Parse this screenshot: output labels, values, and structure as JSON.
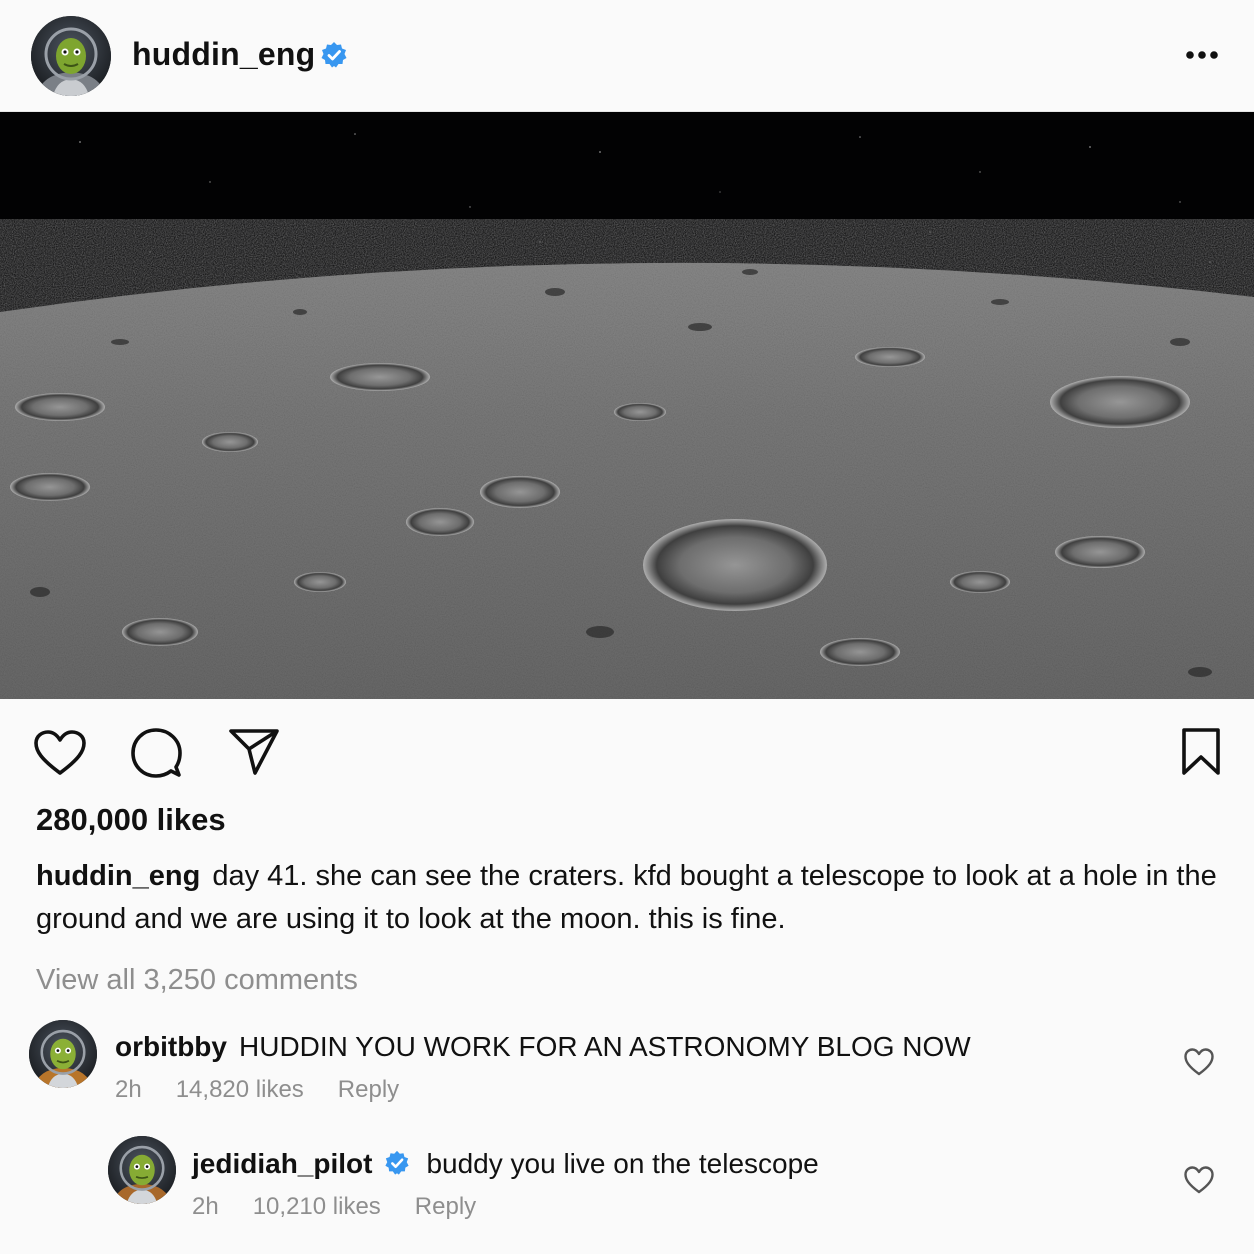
{
  "post": {
    "username": "huddin_eng",
    "verified": true,
    "likes_text": "280,000 likes",
    "caption_user": "huddin_eng",
    "caption_text": "day 41. she can see the craters. kfd bought a telescope to look at a hole in the ground and we are using it to look at the moon. this is fine.",
    "view_all_comments": "View all 3,250 comments"
  },
  "comments": [
    {
      "username": "orbitbby",
      "verified": false,
      "text": "HUDDIN YOU WORK FOR AN ASTRONOMY BLOG NOW",
      "time": "2h",
      "likes": "14,820 likes",
      "reply_label": "Reply"
    },
    {
      "username": "jedidiah_pilot",
      "verified": true,
      "text": "buddy you live on the telescope",
      "time": "2h",
      "likes": "10,210 likes",
      "reply_label": "Reply"
    }
  ],
  "icons": {
    "verified": "verified-badge-icon",
    "more": "more-options-icon",
    "like": "heart-icon",
    "comment": "comment-bubble-icon",
    "share": "paper-plane-icon",
    "save": "bookmark-icon"
  },
  "colors": {
    "verified_blue": "#3897f0",
    "muted_text": "#8e8e8e",
    "background": "#fafafa"
  }
}
